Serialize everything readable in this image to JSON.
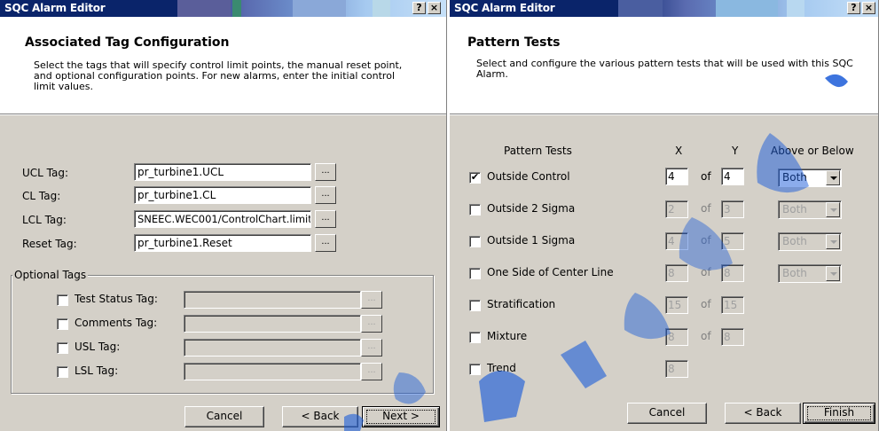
{
  "left_dialog": {
    "title": "SQC Alarm Editor",
    "help_button": "?",
    "close_button": "×",
    "header_title": "Associated Tag Configuration",
    "header_desc": "Select the tags that will specify control limit points, the manual reset point, and optional configuration points.  For new alarms, enter the initial control limit values.",
    "tags": [
      {
        "label": "UCL Tag:",
        "value": "pr_turbine1.UCL"
      },
      {
        "label": "CL Tag:",
        "value": "pr_turbine1.CL"
      },
      {
        "label": "LCL Tag:",
        "value": "SNEEC.WEC001/ControlChart.limit"
      },
      {
        "label": "Reset Tag:",
        "value": "pr_turbine1.Reset"
      }
    ],
    "browse_label": "...",
    "optional_group_title": "Optional Tags",
    "optional_tags": [
      {
        "label": "Test Status Tag:",
        "value": ""
      },
      {
        "label": "Comments Tag:",
        "value": ""
      },
      {
        "label": "USL Tag:",
        "value": ""
      },
      {
        "label": "LSL Tag:",
        "value": ""
      }
    ],
    "buttons": {
      "cancel": "Cancel",
      "back": "< Back",
      "next": "Next >"
    }
  },
  "right_dialog": {
    "title": "SQC Alarm Editor",
    "help_button": "?",
    "close_button": "×",
    "header_title": "Pattern Tests",
    "header_desc": "Select and configure the various pattern tests that will be used with this SQC Alarm.",
    "columns": {
      "tests": "Pattern Tests",
      "x": "X",
      "y": "Y",
      "above_below": "Above or Below"
    },
    "of_label": "of",
    "tests": [
      {
        "label": "Outside Control",
        "checked": true,
        "x": "4",
        "y": "4",
        "mode": "Both"
      },
      {
        "label": "Outside 2 Sigma",
        "checked": false,
        "x": "2",
        "y": "3",
        "mode": "Both"
      },
      {
        "label": "Outside 1 Sigma",
        "checked": false,
        "x": "4",
        "y": "5",
        "mode": "Both"
      },
      {
        "label": "One Side of Center Line",
        "checked": false,
        "x": "8",
        "y": "8",
        "mode": "Both"
      },
      {
        "label": "Stratification",
        "checked": false,
        "x": "15",
        "y": "15"
      },
      {
        "label": "Mixture",
        "checked": false,
        "x": "8",
        "y": "8"
      },
      {
        "label": "Trend",
        "checked": false,
        "x": "8"
      }
    ],
    "check_mark": "✔",
    "buttons": {
      "cancel": "Cancel",
      "back": "< Back",
      "finish": "Finish"
    }
  },
  "colors": {
    "dialog_face": "#d4d0c8",
    "title_bar_active": "#0a246a",
    "watermark": "#1a5bd8"
  }
}
